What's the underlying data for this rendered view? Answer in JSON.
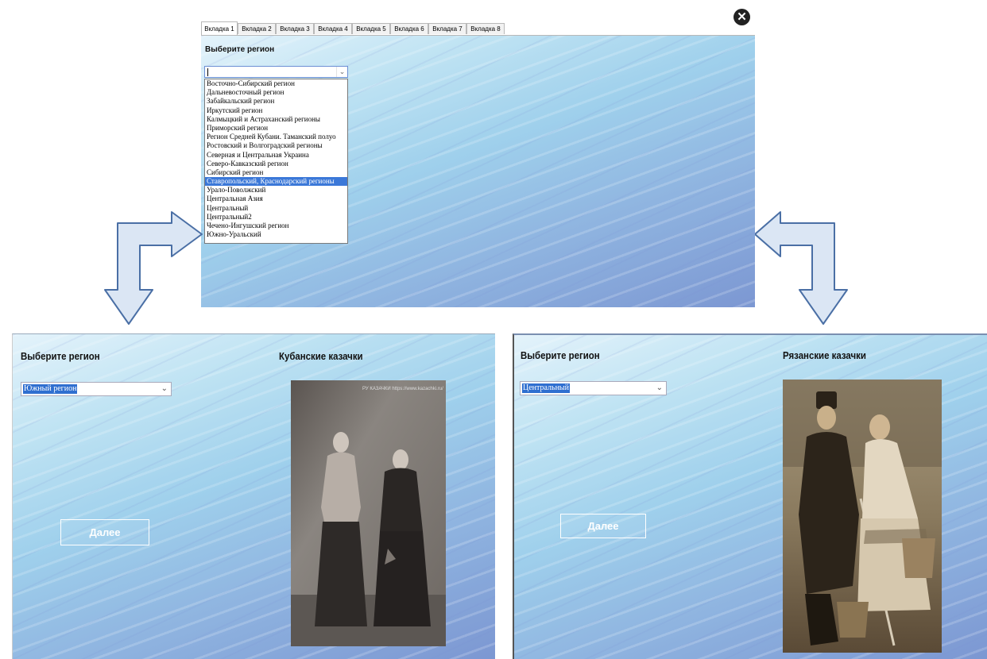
{
  "top_window": {
    "tabs": [
      "Вкладка 1",
      "Вкладка 2",
      "Вкладка 3",
      "Вкладка 4",
      "Вкладка 5",
      "Вкладка 6",
      "Вкладка 7",
      "Вкладка 8"
    ],
    "active_tab": "Вкладка 1",
    "heading": "Выберите регион",
    "combo_value": "",
    "dropdown_items": [
      "Восточно-Сибирский регион",
      "Дальневосточный регион",
      "Забайкальский регион",
      "Иркутский регион",
      "Калмыцкий и Астраханский регионы",
      "Приморский регион",
      "Регион Средней Кубани. Таманский полуо",
      "Ростовский и Волгоградский регионы",
      "Северная и Центральная Украина",
      "Северо-Кавказский регион",
      "Сибирский регион",
      "Ставропольский, Краснодарский регионы",
      "Урало-Поволжский",
      "Центральная Азия",
      "Центральный",
      "Центральный2",
      "Чечено-Ингушский регион",
      "Южно-Уральский"
    ],
    "selected_item": "Ставропольский, Краснодарский регионы",
    "close_icon": "close-circle-icon"
  },
  "left_panel": {
    "heading": "Выберите регион",
    "combo_value": "Южный регион",
    "photo_title": "Кубанские казачки",
    "next_label": "Далее",
    "photo_watermark": "РУ КАЗАЧКИ https://www.kazachki.ru/"
  },
  "right_panel": {
    "heading": "Выберите регион",
    "combo_value": "Центральный",
    "photo_title": "Рязанские казачки",
    "next_label": "Далее"
  },
  "colors": {
    "selection": "#3b78d8",
    "arrow_fill": "#dbe6f4",
    "arrow_stroke": "#4a6fa5"
  }
}
